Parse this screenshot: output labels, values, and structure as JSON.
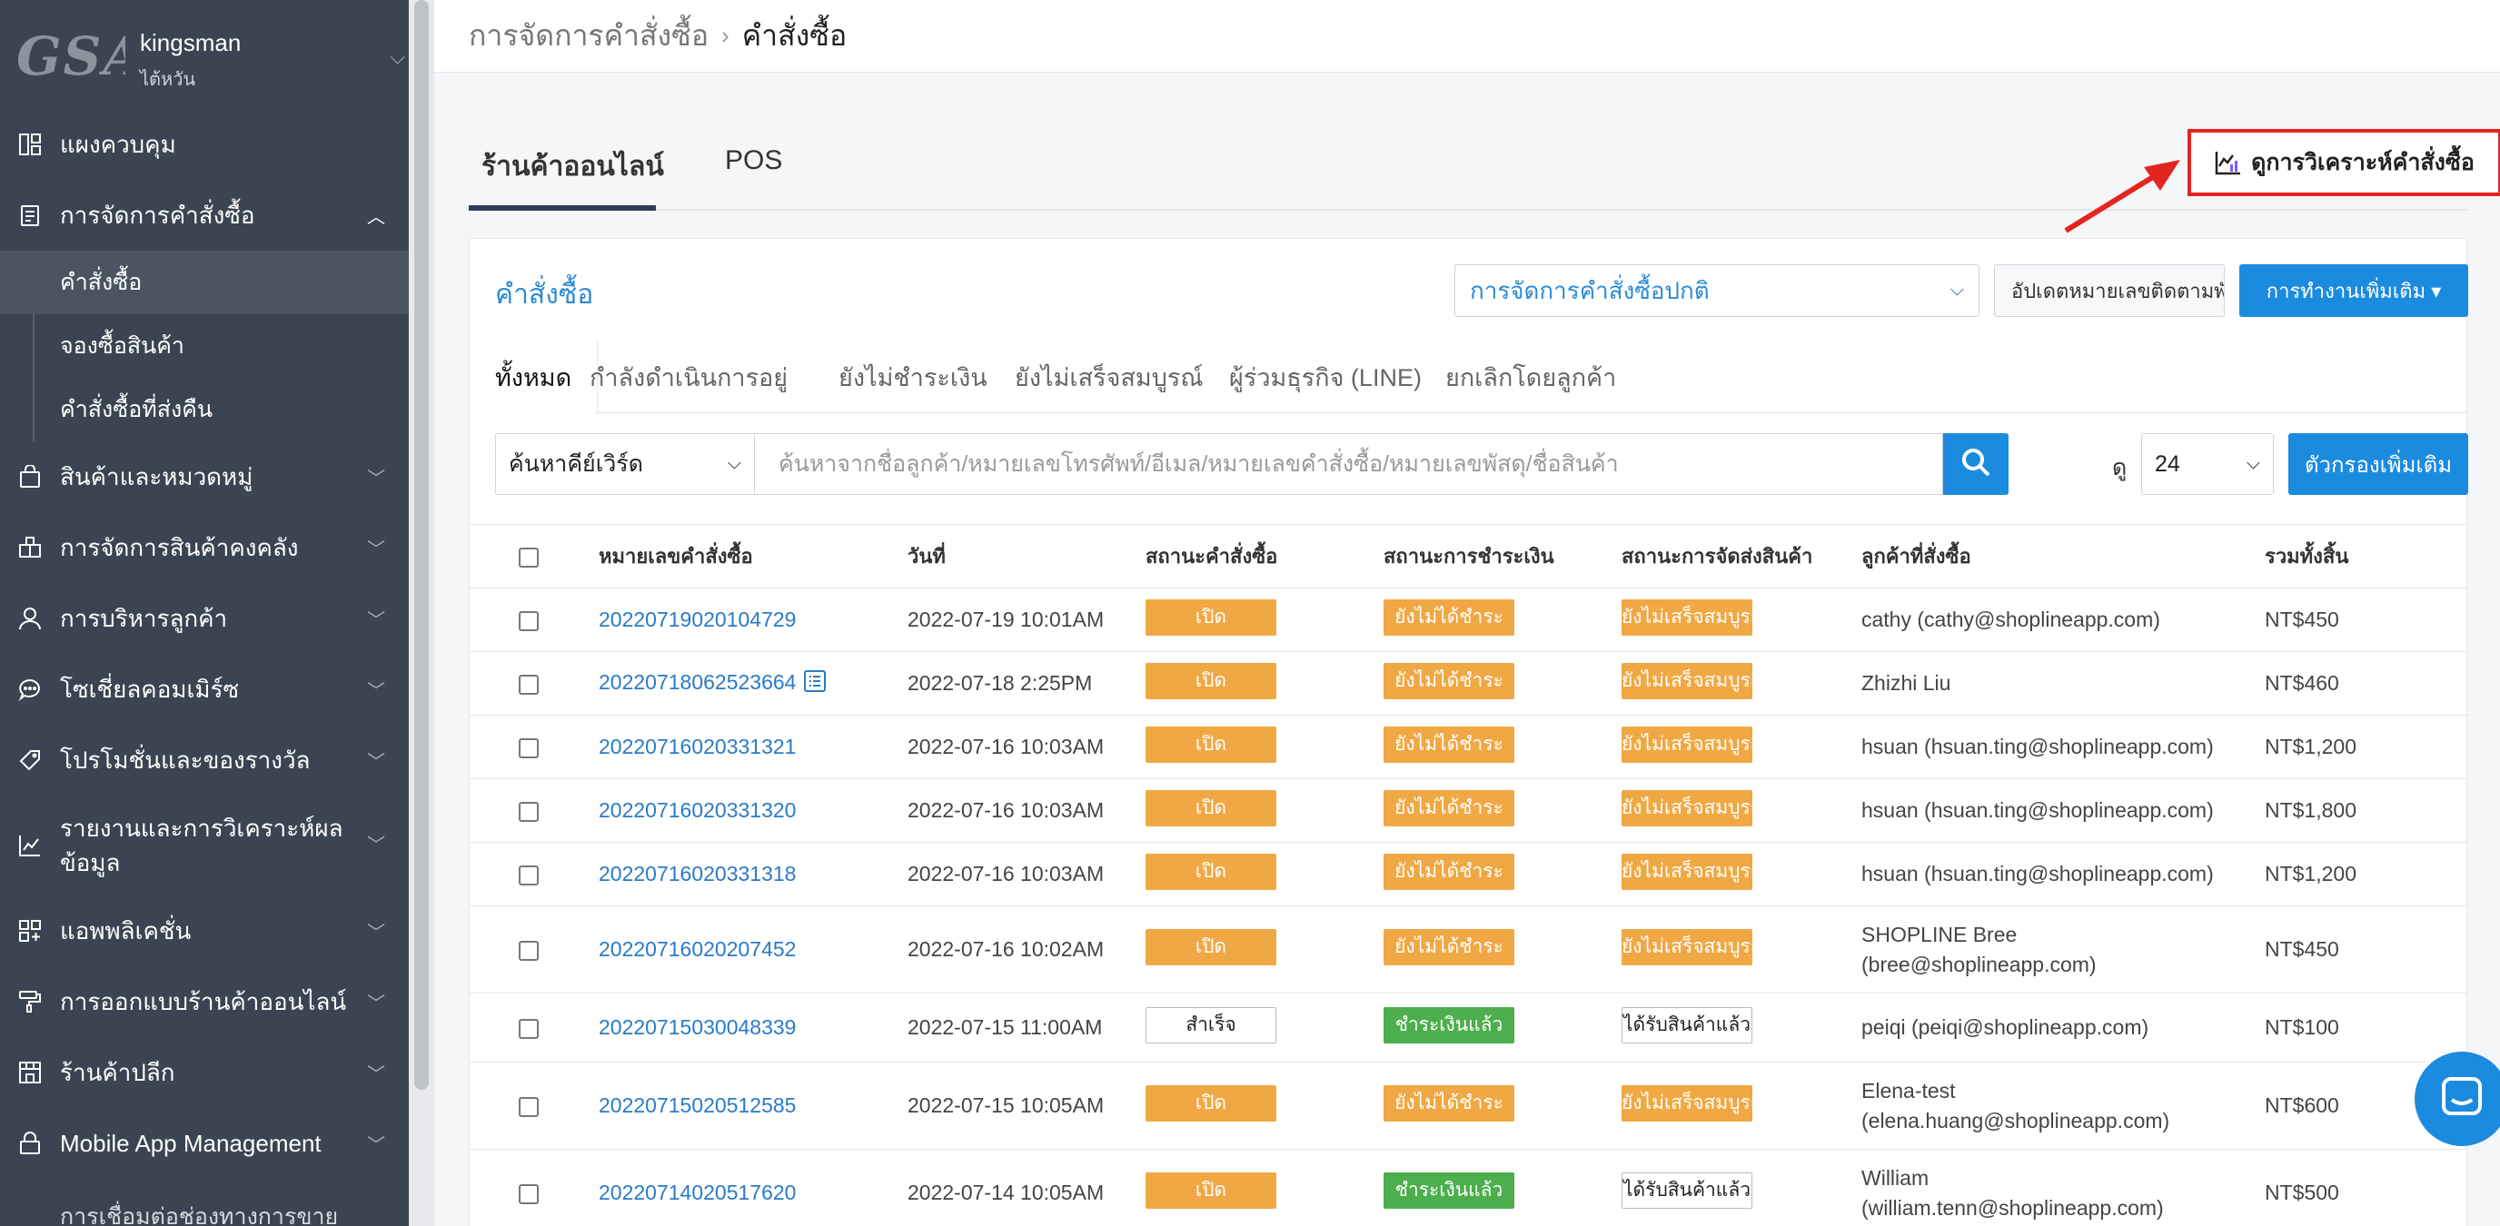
{
  "sidebar": {
    "logo_text": "GSA",
    "shop_name": "kingsman",
    "shop_region": "ไต้หวัน",
    "items": [
      {
        "label": "แผงควบคุม",
        "icon": "dashboard-icon"
      },
      {
        "label": "การจัดการคำสั่งซื้อ",
        "icon": "clipboard-icon"
      },
      {
        "label": "สินค้าและหมวดหมู่",
        "icon": "shopping-bag-icon"
      },
      {
        "label": "การจัดการสินค้าคงคลัง",
        "icon": "warehouse-icon"
      },
      {
        "label": "การบริหารลูกค้า",
        "icon": "user-icon"
      },
      {
        "label": "โซเชี่ยลคอมเมิร์ซ",
        "icon": "chat-icon"
      },
      {
        "label": "โปรโมชั่นและของรางวัล",
        "icon": "tag-icon"
      },
      {
        "label": "รายงานและการวิเคราะห์ผลข้อมูล",
        "icon": "report-icon"
      },
      {
        "label": "แอพพลิเคชั่น",
        "icon": "apps-icon"
      },
      {
        "label": "การออกแบบร้านค้าออนไลน์",
        "icon": "paint-roller-icon"
      },
      {
        "label": "ร้านค้าปลีก",
        "icon": "store-icon"
      },
      {
        "label": "Mobile App Management",
        "icon": "lock-icon"
      }
    ],
    "subitems": [
      {
        "label": "คำสั่งซื้อ"
      },
      {
        "label": "จองซื้อสินค้า"
      },
      {
        "label": "คำสั่งซื้อที่ส่งคืน"
      }
    ],
    "cut_text": "การเชื่อมต่อช่องทางการขาย"
  },
  "breadcrumb": {
    "parent": "การจัดการคำสั่งซื้อ",
    "separator": "›",
    "current": "คำสั่งซื้อ"
  },
  "channel_tabs": [
    {
      "label": "ร้านค้าออนไลน์"
    },
    {
      "label": "POS"
    }
  ],
  "analysis_button": "ดูการวิเคราะห์คำสั่งซื้อ",
  "panel": {
    "title": "คำสั่งซื้อ",
    "mode_select": "การจัดการคำสั่งซื้อปกติ",
    "tracking_button": "อัปเดตหมายเลขติดตามพัสดุ",
    "more_button": "การทำงานเพิ่มเติม ▾",
    "status_tabs": [
      {
        "label": "ทั้งหมด"
      },
      {
        "label": "กำลังดำเนินการอยู่"
      },
      {
        "label": "ยังไม่ชำระเงิน"
      },
      {
        "label": "ยังไม่เสร็จสมบูรณ์"
      },
      {
        "label": "ผู้ร่วมธุรกิจ (LINE)"
      },
      {
        "label": "ยกเลิกโดยลูกค้า"
      }
    ],
    "keyword_select": "ค้นหาคีย์เวิร์ด",
    "search_placeholder": "ค้นหาจากชื่อลูกค้า/หมายเลขโทรศัพท์/อีเมล/หมายเลขคำสั่งซื้อ/หมายเลขพัสดุ/ชื่อสินค้า",
    "view_label": "ดู",
    "view_value": "24",
    "filter_button": "ตัวกรองเพิ่มเติม"
  },
  "table": {
    "headers": [
      "หมายเลขคำสั่งซื้อ",
      "วันที่",
      "สถานะคำสั่งซื้อ",
      "สถานะการชำระเงิน",
      "สถานะการจัดส่งสินค้า",
      "ลูกค้าที่สั่งซื้อ",
      "รวมทั้งสิ้น"
    ],
    "rows": [
      {
        "order": "20220719020104729",
        "date": "2022-07-19 10:01AM",
        "status": "เปิด",
        "payment": "ยังไม่ได้ชำระ",
        "delivery": "ยังไม่เสร็จสมบูรณ์",
        "cust1": "cathy (cathy@shoplineapp.com)",
        "cust2": "",
        "total": "NT$450"
      },
      {
        "order": "20220718062523664",
        "date": "2022-07-18 2:25PM",
        "status": "เปิด",
        "payment": "ยังไม่ได้ชำระ",
        "delivery": "ยังไม่เสร็จสมบูรณ์",
        "cust1": "Zhizhi Liu",
        "cust2": "",
        "total": "NT$460"
      },
      {
        "order": "20220716020331321",
        "date": "2022-07-16 10:03AM",
        "status": "เปิด",
        "payment": "ยังไม่ได้ชำระ",
        "delivery": "ยังไม่เสร็จสมบูรณ์",
        "cust1": "hsuan (hsuan.ting@shoplineapp.com)",
        "cust2": "",
        "total": "NT$1,200"
      },
      {
        "order": "20220716020331320",
        "date": "2022-07-16 10:03AM",
        "status": "เปิด",
        "payment": "ยังไม่ได้ชำระ",
        "delivery": "ยังไม่เสร็จสมบูรณ์",
        "cust1": "hsuan (hsuan.ting@shoplineapp.com)",
        "cust2": "",
        "total": "NT$1,800"
      },
      {
        "order": "20220716020331318",
        "date": "2022-07-16 10:03AM",
        "status": "เปิด",
        "payment": "ยังไม่ได้ชำระ",
        "delivery": "ยังไม่เสร็จสมบูรณ์",
        "cust1": "hsuan (hsuan.ting@shoplineapp.com)",
        "cust2": "",
        "total": "NT$1,200"
      },
      {
        "order": "20220716020207452",
        "date": "2022-07-16 10:02AM",
        "status": "เปิด",
        "payment": "ยังไม่ได้ชำระ",
        "delivery": "ยังไม่เสร็จสมบูรณ์",
        "cust1": "SHOPLINE Bree",
        "cust2": "(bree@shoplineapp.com)",
        "total": "NT$450"
      },
      {
        "order": "20220715030048339",
        "date": "2022-07-15 11:00AM",
        "status": "สำเร็จ",
        "payment": "ชำระเงินแล้ว",
        "delivery": "ได้รับสินค้าแล้ว",
        "cust1": "peiqi (peiqi@shoplineapp.com)",
        "cust2": "",
        "total": "NT$100"
      },
      {
        "order": "20220715020512585",
        "date": "2022-07-15 10:05AM",
        "status": "เปิด",
        "payment": "ยังไม่ได้ชำระ",
        "delivery": "ยังไม่เสร็จสมบูรณ์",
        "cust1": "Elena-test",
        "cust2": "(elena.huang@shoplineapp.com)",
        "total": "NT$600"
      },
      {
        "order": "20220714020517620",
        "date": "2022-07-14 10:05AM",
        "status": "เปิด",
        "payment": "ชำระเงินแล้ว",
        "delivery": "ได้รับสินค้าแล้ว",
        "cust1": "William",
        "cust2": "(william.tenn@shoplineapp.com)",
        "total": "NT$500"
      }
    ]
  },
  "colors": {
    "sidebar_bg": "#3b4452",
    "primary_blue": "#1b8be0",
    "link_blue": "#2a7ac8",
    "badge_orange": "#f0a844",
    "badge_green": "#4cae4c",
    "annotation_red": "#e32520"
  }
}
